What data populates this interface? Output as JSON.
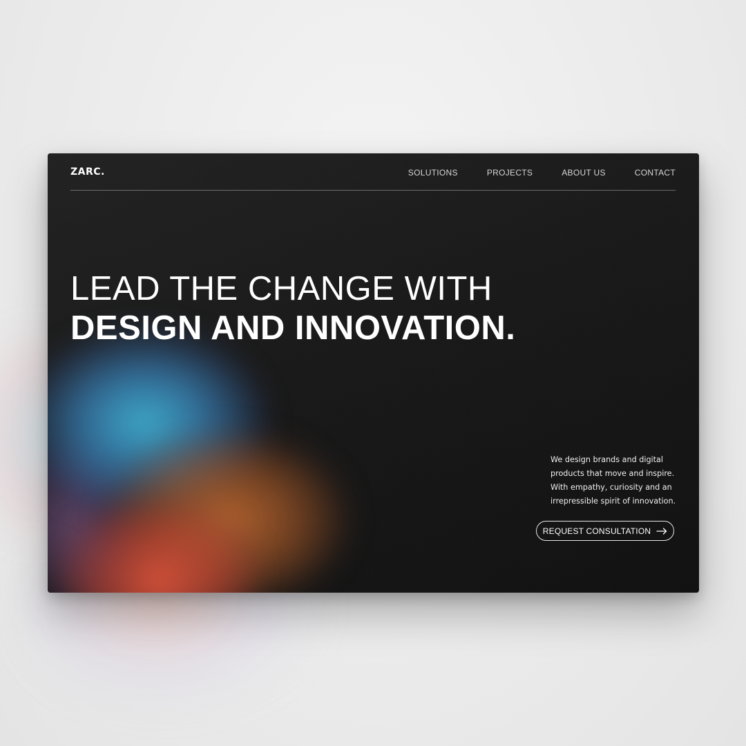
{
  "site": {
    "logo": "ZARC."
  },
  "nav": {
    "items": [
      {
        "label": "SOLUTIONS"
      },
      {
        "label": "PROJECTS"
      },
      {
        "label": "ABOUT US"
      },
      {
        "label": "CONTACT"
      }
    ]
  },
  "hero": {
    "headline_line1": "LEAD THE CHANGE WITH",
    "headline_line2": "DESIGN AND INNOVATION.",
    "description": "We design brands and digital products that move and inspire. With empathy, curiosity and an irrepressible spirit of innovation.",
    "cta_label": "REQUEST CONSULTATION",
    "cta_icon": "arrow-right-icon"
  },
  "colors": {
    "card_background": "#161616",
    "text": "#ffffff",
    "page_background": "#ececec",
    "gradient_blue": "#40b4d7",
    "gradient_orange": "#c86e32",
    "gradient_red": "#e1553c"
  }
}
